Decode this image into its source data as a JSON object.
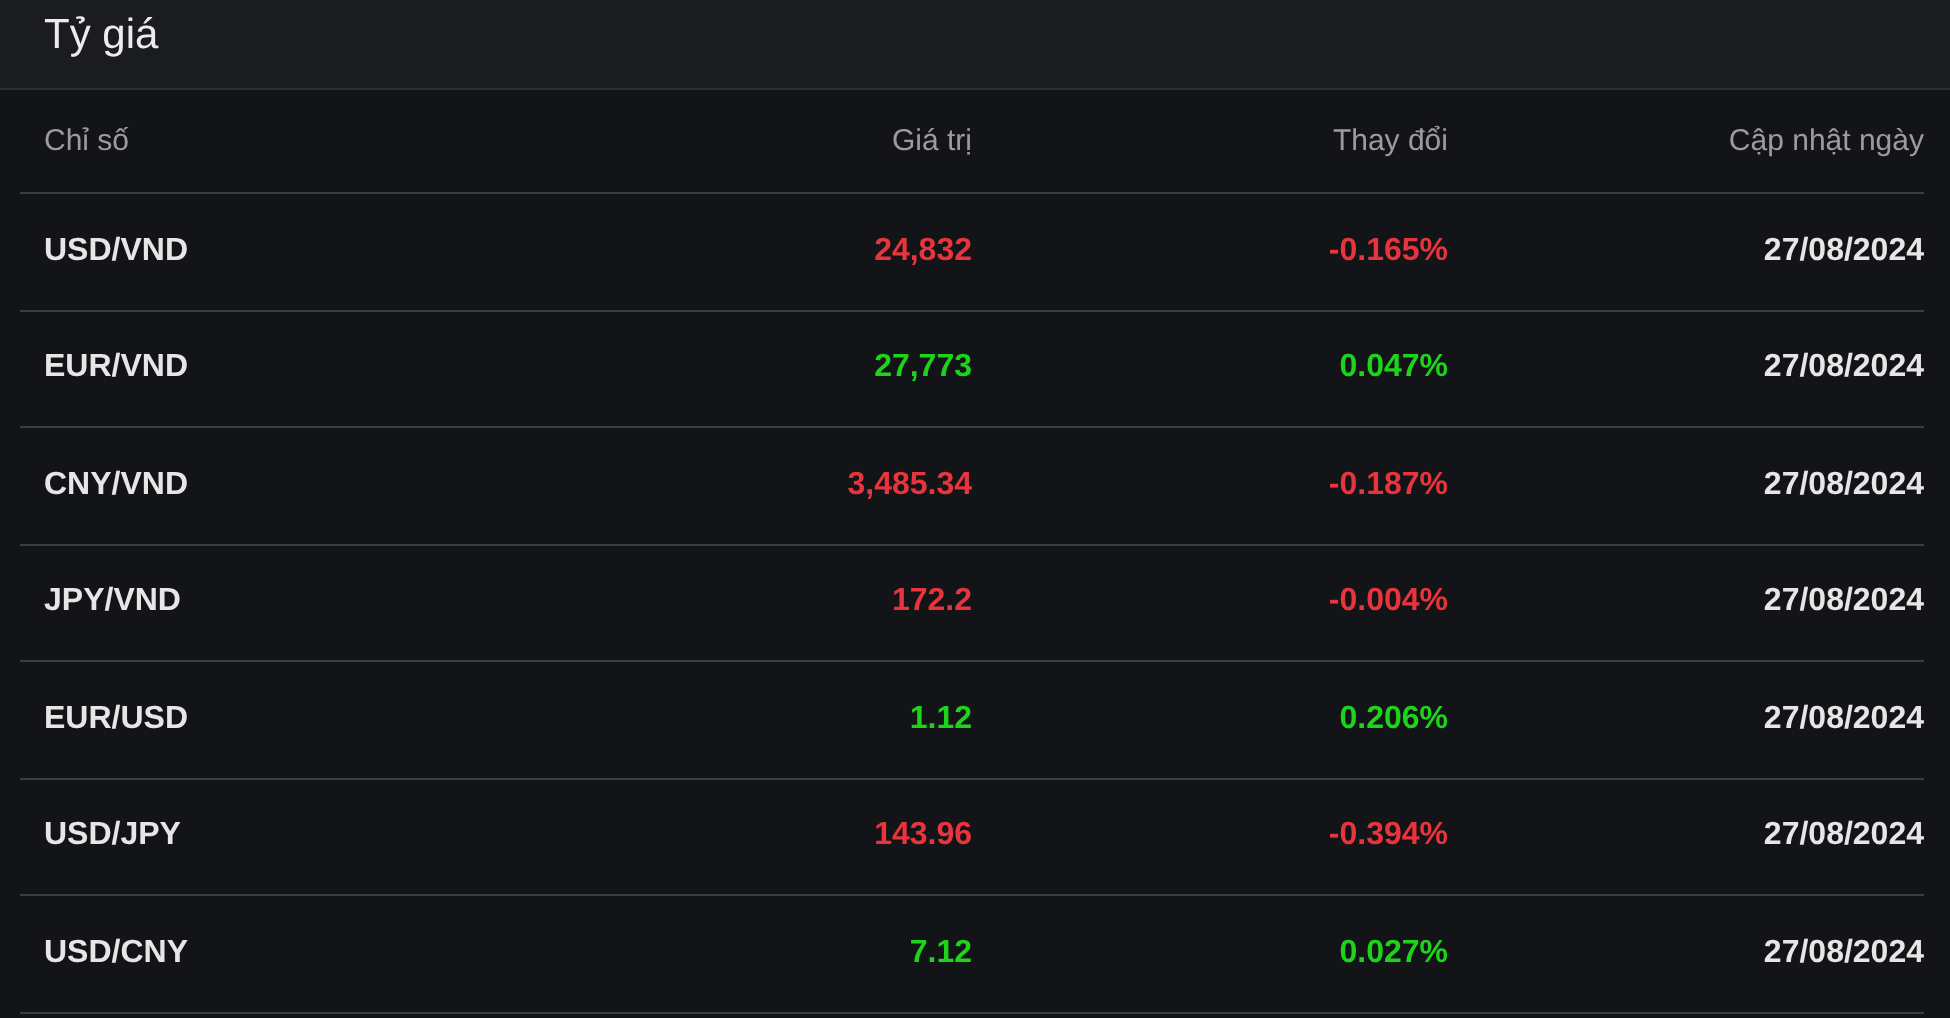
{
  "title": "Tỷ giá",
  "table": {
    "columns": [
      "Chỉ số",
      "Giá trị",
      "Thay đổi",
      "Cập nhật ngày"
    ],
    "rows": [
      {
        "name": "USD/VND",
        "value": "24,832",
        "change": "-0.165%",
        "date": "27/08/2024",
        "color": "#e8343c"
      },
      {
        "name": "EUR/VND",
        "value": "27,773",
        "change": "0.047%",
        "date": "27/08/2024",
        "color": "#1ed41a"
      },
      {
        "name": "CNY/VND",
        "value": "3,485.34",
        "change": "-0.187%",
        "date": "27/08/2024",
        "color": "#e8343c"
      },
      {
        "name": "JPY/VND",
        "value": "172.2",
        "change": "-0.004%",
        "date": "27/08/2024",
        "color": "#e8343c"
      },
      {
        "name": "EUR/USD",
        "value": "1.12",
        "change": "0.206%",
        "date": "27/08/2024",
        "color": "#1ed41a"
      },
      {
        "name": "USD/JPY",
        "value": "143.96",
        "change": "-0.394%",
        "date": "27/08/2024",
        "color": "#e8343c"
      },
      {
        "name": "USD/CNY",
        "value": "7.12",
        "change": "0.027%",
        "date": "27/08/2024",
        "color": "#1ed41a"
      }
    ]
  }
}
